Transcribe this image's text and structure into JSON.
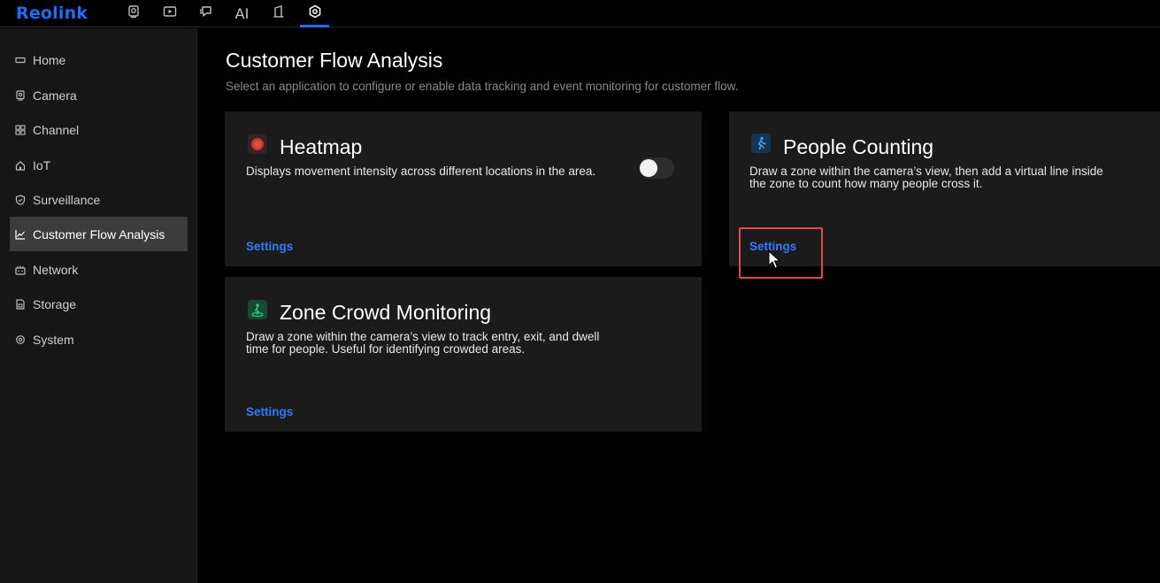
{
  "app": {
    "logo": "Reolink"
  },
  "topnav": {
    "items": [
      {
        "name": "live-view",
        "icon": "camera-icon"
      },
      {
        "name": "playback",
        "icon": "playback-icon"
      },
      {
        "name": "messages",
        "icon": "chat-icon"
      },
      {
        "name": "ai",
        "label": "AI"
      },
      {
        "name": "devices",
        "icon": "device-icon"
      },
      {
        "name": "settings",
        "icon": "settings-gear-icon",
        "active": true
      }
    ]
  },
  "sidebar": {
    "items": [
      {
        "label": "Home",
        "icon": "home-icon"
      },
      {
        "label": "Camera",
        "icon": "camera-icon"
      },
      {
        "label": "Channel",
        "icon": "grid-icon"
      },
      {
        "label": "IoT",
        "icon": "iot-home-icon"
      },
      {
        "label": "Surveillance",
        "icon": "shield-icon"
      },
      {
        "label": "Customer Flow Analysis",
        "icon": "chart-icon",
        "active": true
      },
      {
        "label": "Network",
        "icon": "network-icon"
      },
      {
        "label": "Storage",
        "icon": "storage-icon"
      },
      {
        "label": "System",
        "icon": "gear-icon"
      }
    ]
  },
  "main": {
    "title": "Customer Flow Analysis",
    "subtitle": "Select an application to configure or enable data tracking and event monitoring for customer flow.",
    "cards": {
      "heatmap": {
        "title": "Heatmap",
        "description": "Displays movement intensity across different locations in the area.",
        "settings_label": "Settings",
        "enabled": false,
        "icon_color": "#e0443d"
      },
      "people_counting": {
        "title": "People Counting",
        "description_line1": "Draw a zone within the camera’s view, then add a virtual line inside",
        "description_line2": "the zone to count how many people cross it.",
        "settings_label": "Settings",
        "icon_color": "#2a8bd6"
      },
      "zone_crowd": {
        "title": "Zone Crowd Monitoring",
        "description_line1": "Draw a zone within the camera’s view to track entry, exit, and dwell",
        "description_line2": "time for people. Useful for identifying crowded areas.",
        "settings_label": "Settings",
        "icon_color": "#2e9b6b"
      }
    }
  },
  "colors": {
    "accent": "#1f6fff",
    "link": "#2f7bff",
    "highlight": "#e34b4b"
  }
}
